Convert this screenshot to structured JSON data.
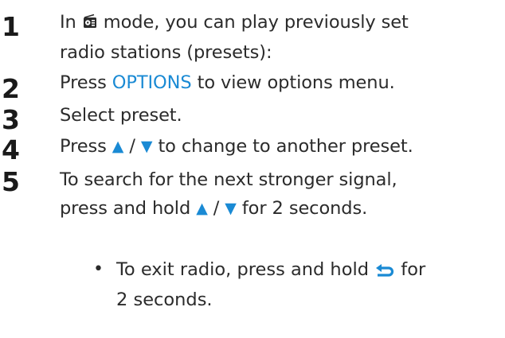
{
  "steps": [
    {
      "number": "1",
      "line1_before": "In ",
      "line1_after": " mode, you can play previously set",
      "line2": "radio stations (presets):",
      "icon": "radio-icon"
    },
    {
      "number": "2",
      "before": "Press ",
      "highlight": "OPTIONS",
      "after": " to view options menu."
    },
    {
      "number": "3",
      "text": "Select preset."
    },
    {
      "number": "4",
      "before": "Press ",
      "up": "▲",
      "sep": " / ",
      "down": "▼",
      "after": " to change to another preset."
    },
    {
      "number": "5",
      "line1": "To search for the next stronger signal,",
      "line2_before": "press and hold ",
      "up": "▲",
      "sep": " / ",
      "down": "▼",
      "line2_after": " for 2 seconds."
    }
  ],
  "subitem": {
    "bullet": "•",
    "line1_before": "To exit radio, press and hold ",
    "line1_after": " for",
    "line2": "2 seconds.",
    "icon": "back-arrow-icon"
  },
  "colors": {
    "accent": "#1a8ad4",
    "text": "#2b2b2b"
  }
}
